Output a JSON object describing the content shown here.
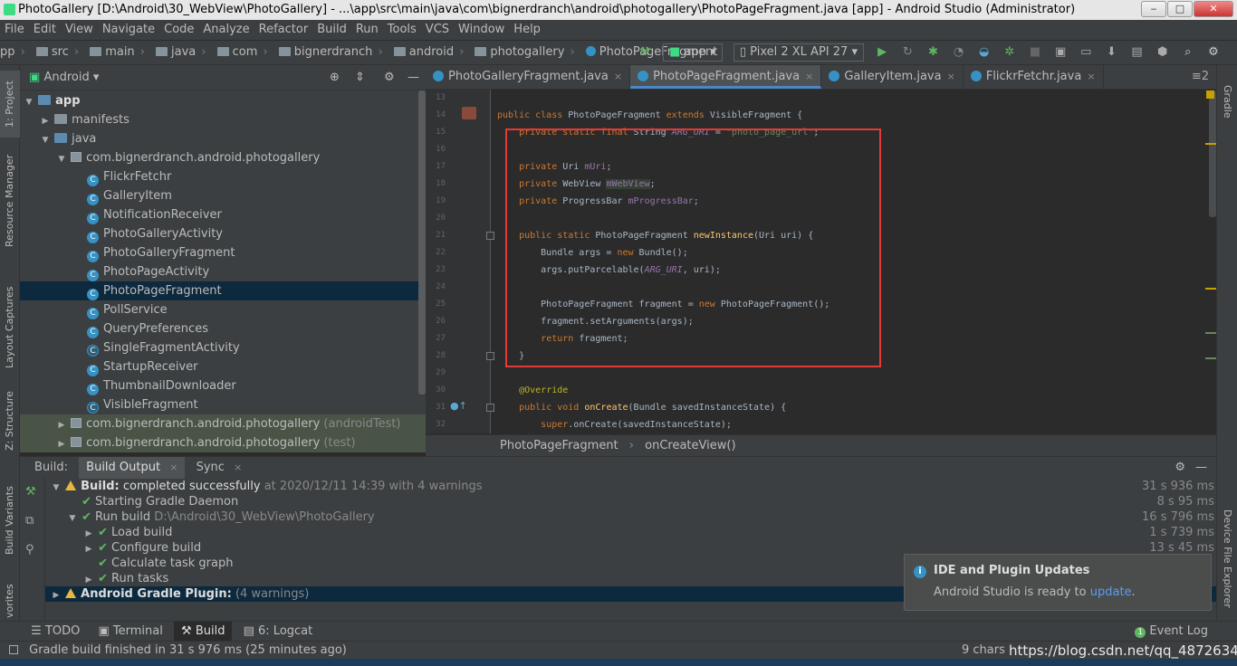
{
  "window": {
    "title": "PhotoGallery [D:\\Android\\30_WebView\\PhotoGallery] - ...\\app\\src\\main\\java\\com\\bignerdranch\\android\\photogallery\\PhotoPageFragment.java [app] - Android Studio (Administrator)",
    "minimize": "‒",
    "maximize": "□",
    "close": "✕"
  },
  "menu": [
    "File",
    "Edit",
    "View",
    "Navigate",
    "Code",
    "Analyze",
    "Refactor",
    "Build",
    "Run",
    "Tools",
    "VCS",
    "Window",
    "Help"
  ],
  "breadcrumb": [
    "pp",
    "src",
    "main",
    "java",
    "com",
    "bignerdranch",
    "android",
    "photogallery",
    "PhotoPageFragment"
  ],
  "toolbar": {
    "run_config": "app",
    "device": "Pixel 2 XL API 27"
  },
  "left_strip": {
    "project": "1: Project",
    "resource": "Resource Manager",
    "layout": "Layout Captures",
    "structure": "Z: Structure",
    "variants": "Build Variants",
    "favorites": "vorites"
  },
  "right_strip": {
    "gradle": "Gradle",
    "device_explorer": "Device File Explorer"
  },
  "project": {
    "view_label": "Android",
    "tree": [
      {
        "label": "app",
        "level": 0,
        "type": "module",
        "expanded": true
      },
      {
        "label": "manifests",
        "level": 1,
        "type": "folder",
        "expanded": false
      },
      {
        "label": "java",
        "level": 1,
        "type": "folder",
        "expanded": true
      },
      {
        "label": "com.bignerdranch.android.photogallery",
        "level": 2,
        "type": "package",
        "expanded": true
      },
      {
        "label": "FlickrFetchr",
        "level": 3,
        "type": "class"
      },
      {
        "label": "GalleryItem",
        "level": 3,
        "type": "class"
      },
      {
        "label": "NotificationReceiver",
        "level": 3,
        "type": "class"
      },
      {
        "label": "PhotoGalleryActivity",
        "level": 3,
        "type": "class"
      },
      {
        "label": "PhotoGalleryFragment",
        "level": 3,
        "type": "class"
      },
      {
        "label": "PhotoPageActivity",
        "level": 3,
        "type": "class"
      },
      {
        "label": "PhotoPageFragment",
        "level": 3,
        "type": "class",
        "selected": true
      },
      {
        "label": "PollService",
        "level": 3,
        "type": "class"
      },
      {
        "label": "QueryPreferences",
        "level": 3,
        "type": "class"
      },
      {
        "label": "SingleFragmentActivity",
        "level": 3,
        "type": "abstract"
      },
      {
        "label": "StartupReceiver",
        "level": 3,
        "type": "class"
      },
      {
        "label": "ThumbnailDownloader",
        "level": 3,
        "type": "class"
      },
      {
        "label": "VisibleFragment",
        "level": 3,
        "type": "abstract"
      },
      {
        "label": "com.bignerdranch.android.photogallery",
        "suffix": "(androidTest)",
        "level": 2,
        "type": "package",
        "expanded": false,
        "green": true
      },
      {
        "label": "com.bignerdranch.android.photogallery",
        "suffix": "(test)",
        "level": 2,
        "type": "package",
        "expanded": false,
        "green": true
      }
    ]
  },
  "editor_tabs": [
    {
      "label": "PhotoGalleryFragment.java",
      "active": false
    },
    {
      "label": "PhotoPageFragment.java",
      "active": true
    },
    {
      "label": "GalleryItem.java",
      "active": false
    },
    {
      "label": "FlickrFetchr.java",
      "active": false
    }
  ],
  "editor_tabs_more": "≡2",
  "code_lines": [
    {
      "n": "13",
      "html": ""
    },
    {
      "n": "14",
      "html": "<span class='kw'>public class</span> PhotoPageFragment <span class='kw'>extends</span> VisibleFragment {"
    },
    {
      "n": "15",
      "html": "    <span class='kw'>private static final</span> String <span class='fld it'>ARG_URI</span> = <span class='str'>\"photo_page_url\"</span>;"
    },
    {
      "n": "16",
      "html": ""
    },
    {
      "n": "17",
      "html": "    <span class='kw'>private</span> Uri <span class='fld'>mUri</span>;"
    },
    {
      "n": "18",
      "html": "    <span class='kw'>private</span> WebView <span class='fld' style='background:#344134'>mWebView</span>;"
    },
    {
      "n": "19",
      "html": "    <span class='kw'>private</span> ProgressBar <span class='fld'>mProgressBar</span>;"
    },
    {
      "n": "20",
      "html": ""
    },
    {
      "n": "21",
      "html": "    <span class='kw'>public static</span> PhotoPageFragment <span class='fn'>newInstance</span>(Uri uri) {"
    },
    {
      "n": "22",
      "html": "        Bundle args = <span class='kw'>new</span> Bundle();"
    },
    {
      "n": "23",
      "html": "        args.putParcelable(<span class='fld it'>ARG_URI</span>, uri);"
    },
    {
      "n": "24",
      "html": ""
    },
    {
      "n": "25",
      "html": "        PhotoPageFragment fragment = <span class='kw'>new</span> PhotoPageFragment();"
    },
    {
      "n": "26",
      "html": "        fragment.setArguments(args);"
    },
    {
      "n": "27",
      "html": "        <span class='kw'>return</span> fragment;"
    },
    {
      "n": "28",
      "html": "    }"
    },
    {
      "n": "29",
      "html": ""
    },
    {
      "n": "30",
      "html": "    <span class='ann'>@Override</span>"
    },
    {
      "n": "31",
      "html": "    <span class='kw'>public void</span> <span class='fn'>onCreate</span>(Bundle savedInstanceState) {"
    },
    {
      "n": "32",
      "html": "        <span class='kw'>super</span>.onCreate(savedInstanceState);"
    }
  ],
  "editor_breadcrumb": [
    "PhotoPageFragment",
    "onCreateView()"
  ],
  "build": {
    "tabs": [
      "Build:",
      "Build Output",
      "Sync"
    ],
    "rows": [
      {
        "indent": 0,
        "arrow": "▼",
        "icon": "warn",
        "text": "Build:",
        "text2": " completed successfully",
        "dim": " at 2020/12/11 14:39   with 4 warnings",
        "time": "31 s 936 ms",
        "bold": true
      },
      {
        "indent": 1,
        "arrow": "",
        "icon": "check",
        "text": "Starting Gradle Daemon",
        "time": "8 s 95 ms"
      },
      {
        "indent": 1,
        "arrow": "▼",
        "icon": "check",
        "text": "Run build",
        "dim": " D:\\Android\\30_WebView\\PhotoGallery",
        "time": "16 s 796 ms"
      },
      {
        "indent": 2,
        "arrow": "▶",
        "icon": "check",
        "text": "Load build",
        "time": "1 s 739 ms"
      },
      {
        "indent": 2,
        "arrow": "▶",
        "icon": "check",
        "text": "Configure build",
        "time": "13 s 45 ms"
      },
      {
        "indent": 2,
        "arrow": "",
        "icon": "check",
        "text": "Calculate task graph",
        "time": ""
      },
      {
        "indent": 2,
        "arrow": "▶",
        "icon": "check",
        "text": "Run tasks",
        "time": ""
      },
      {
        "indent": 0,
        "arrow": "▶",
        "icon": "warn",
        "text": "Android Gradle Plugin:",
        "dim": " (4 warnings)",
        "time": "",
        "bold": true,
        "selected": true
      }
    ]
  },
  "notification": {
    "title": "IDE and Plugin Updates",
    "body": "Android Studio is ready to ",
    "link": "update",
    "tail": "."
  },
  "bottom_tabs": [
    {
      "label": "TODO",
      "active": false
    },
    {
      "label": "Terminal",
      "active": false
    },
    {
      "label": "Build",
      "active": true
    },
    {
      "label": "6: Logcat",
      "active": false
    }
  ],
  "event_log": {
    "count": "1",
    "label": "Event Log"
  },
  "status": {
    "message": "Gradle build finished in 31 s 976 ms (25 minutes ago)",
    "chars": "9 chars",
    "watermark": "https://blog.csdn.net/qq_4872634"
  },
  "colors": {
    "accent": "#4a88c7",
    "highlight_box": "#e53935",
    "bg": "#2b2b2b",
    "panel": "#3c3f41"
  }
}
